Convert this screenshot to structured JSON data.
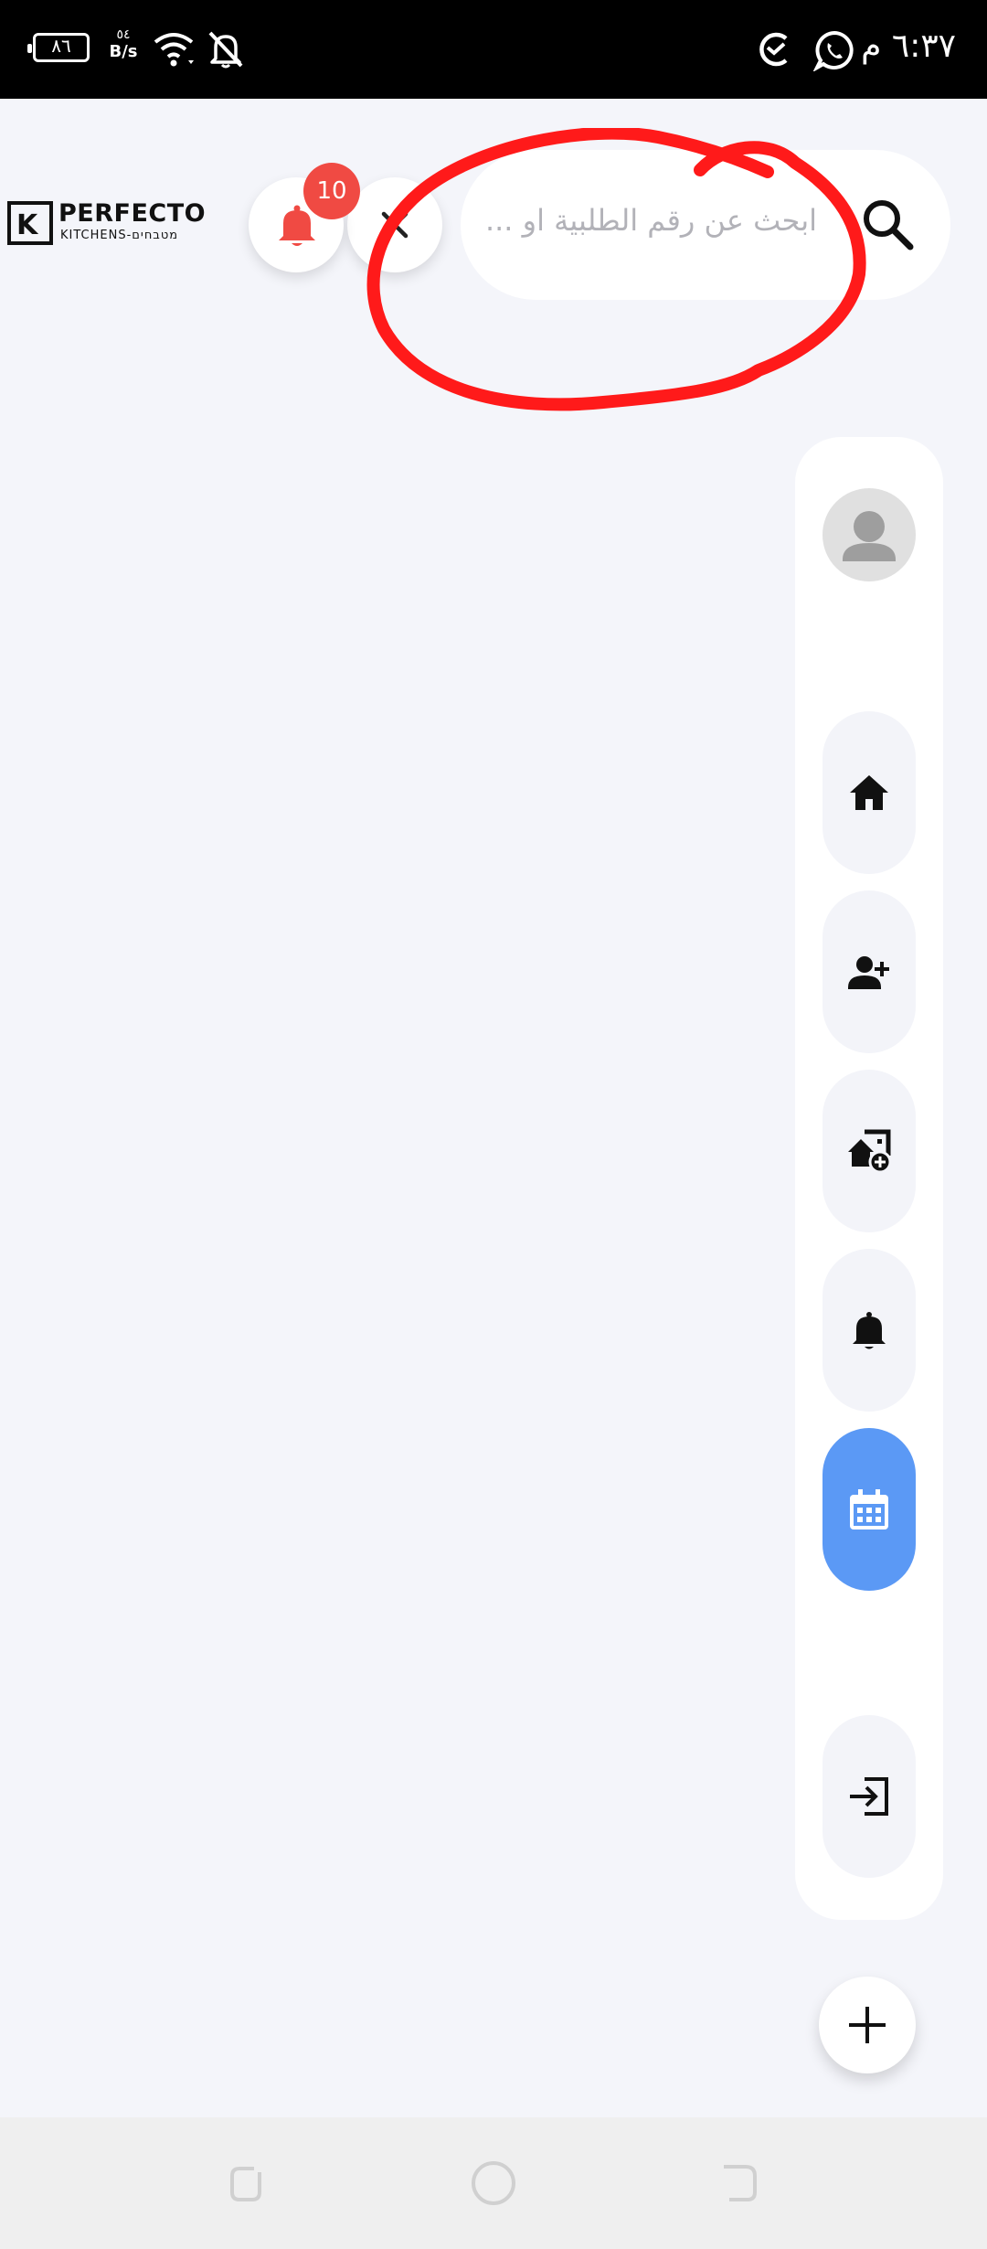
{
  "status_bar": {
    "battery": "٨٦",
    "net_speed_value": "٥٤",
    "net_speed_unit": "B/s",
    "time": "٦:٣٧ م"
  },
  "header": {
    "logo_title": "PERFECTO",
    "logo_subtitle": "KITCHENS-מטבחים",
    "logo_mark": "K",
    "notification_count": "10",
    "notification_color": "#f04a43",
    "search": {
      "placeholder": "ابحث عن رقم الطلبية او ..."
    }
  },
  "sidebar": {
    "items": [
      {
        "icon": "home-icon",
        "active": false
      },
      {
        "icon": "person-add-icon",
        "active": false
      },
      {
        "icon": "add-home-icon",
        "active": false
      },
      {
        "icon": "bell-icon",
        "active": false
      },
      {
        "icon": "calendar-icon",
        "active": true
      },
      {
        "icon": "logout-icon",
        "active": false
      }
    ],
    "active_color": "#5b99f5"
  },
  "annotation_color": "#ff1a1a"
}
